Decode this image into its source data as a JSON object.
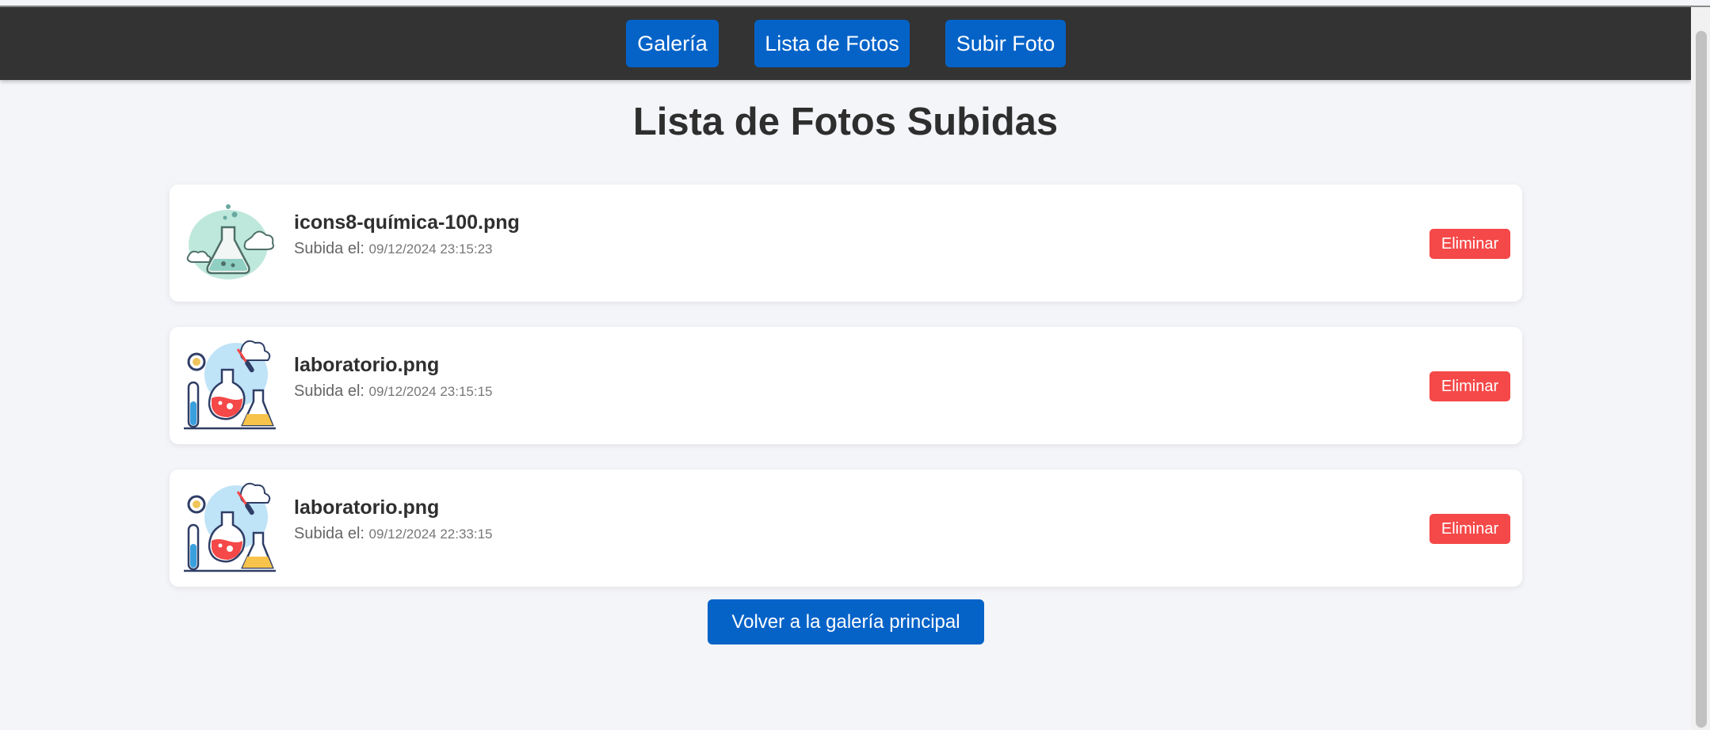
{
  "nav": {
    "gallery_label": "Galería",
    "list_label": "Lista de Fotos",
    "upload_label": "Subir Foto"
  },
  "page_title": "Lista de Fotos Subidas",
  "photos": [
    {
      "filename": "icons8-química-100.png",
      "uploaded_prefix": "Subida el:",
      "uploaded_at": "09/12/2024 23:15:23",
      "delete_label": "Eliminar",
      "icon": "chemistry-flask-icon"
    },
    {
      "filename": "laboratorio.png",
      "uploaded_prefix": "Subida el:",
      "uploaded_at": "09/12/2024 23:15:15",
      "delete_label": "Eliminar",
      "icon": "laboratory-icon"
    },
    {
      "filename": "laboratorio.png",
      "uploaded_prefix": "Subida el:",
      "uploaded_at": "09/12/2024 22:33:15",
      "delete_label": "Eliminar",
      "icon": "laboratory-icon"
    }
  ],
  "back_label": "Volver a la galería principal",
  "colors": {
    "navbar": "#333333",
    "primary": "#0563c8",
    "danger": "#f54848",
    "background": "#f4f5f9"
  }
}
